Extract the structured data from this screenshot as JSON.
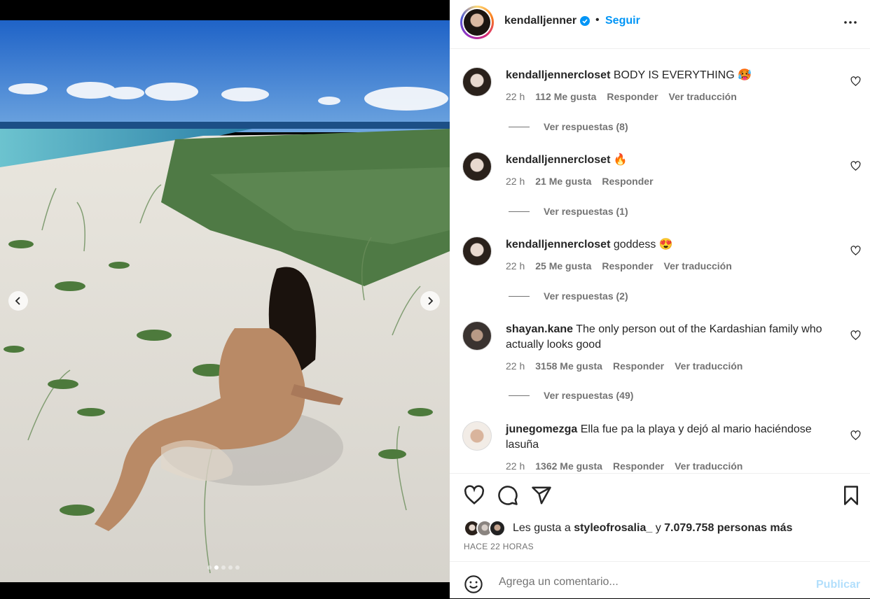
{
  "post": {
    "author": "kendalljenner",
    "verified": true,
    "follow_label": "Seguir",
    "separator": "•"
  },
  "media": {
    "slide_count": 5,
    "active_slide": 2
  },
  "comments": [
    {
      "user": "kendalljennercloset",
      "text": "BODY IS EVERYTHING 🥵",
      "time": "22 h",
      "likes": "112 Me gusta",
      "reply": "Responder",
      "translate": "Ver traducción",
      "replies": "Ver respuestas (8)"
    },
    {
      "user": "kendalljennercloset",
      "text": "🔥",
      "time": "22 h",
      "likes": "21 Me gusta",
      "reply": "Responder",
      "translate": "",
      "replies": "Ver respuestas (1)"
    },
    {
      "user": "kendalljennercloset",
      "text": "goddess 😍",
      "time": "22 h",
      "likes": "25 Me gusta",
      "reply": "Responder",
      "translate": "Ver traducción",
      "replies": "Ver respuestas (2)"
    },
    {
      "user": "shayan.kane",
      "text": "The only person out of the Kardashian family who actually looks good",
      "time": "22 h",
      "likes": "3158 Me gusta",
      "reply": "Responder",
      "translate": "Ver traducción",
      "replies": "Ver respuestas (49)"
    },
    {
      "user": "junegomezga",
      "text": "Ella fue pa la playa y dejó al mario haciéndose lasuña",
      "time": "22 h",
      "likes": "1362 Me gusta",
      "reply": "Responder",
      "translate": "Ver traducción",
      "replies": ""
    }
  ],
  "likes": {
    "prefix": "Les gusta a",
    "user": "styleofrosalia_",
    "conj": "y",
    "count": "7.079.758 personas más"
  },
  "time_ago": "HACE 22 HORAS",
  "comment_box": {
    "placeholder": "Agrega un comentario...",
    "publish": "Publicar"
  },
  "colors": {
    "accent": "#0095f6",
    "publish_disabled": "#b2dffc",
    "muted": "#737373"
  }
}
